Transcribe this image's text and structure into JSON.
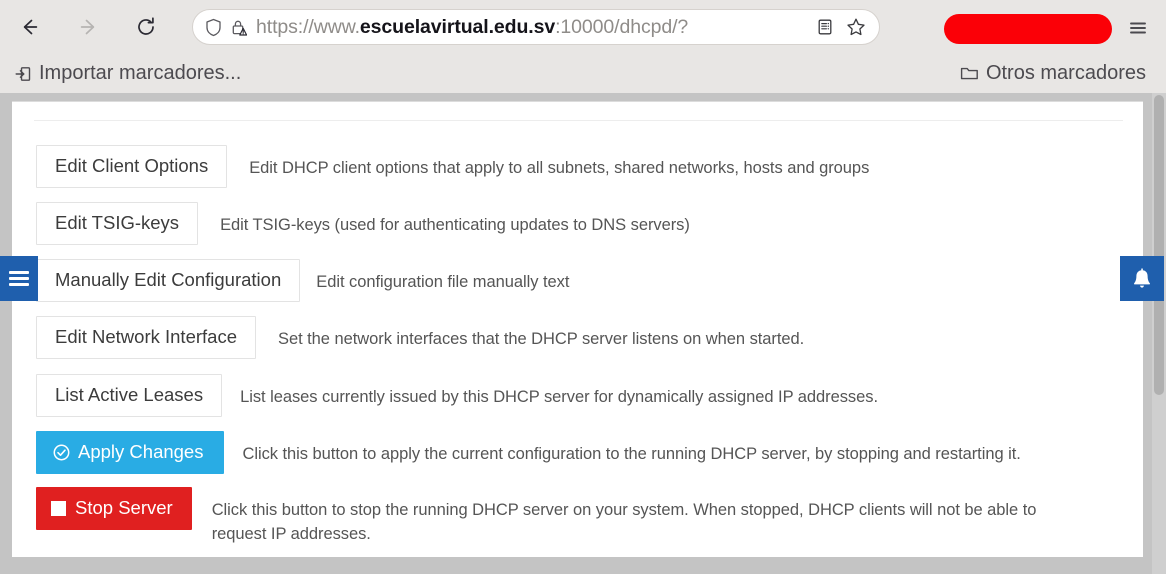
{
  "browser": {
    "nav": {
      "back_icon": "arrow-left-icon",
      "back_label": "←",
      "forward_icon": "arrow-right-icon",
      "forward_label": "→",
      "reload_icon": "reload-icon",
      "reload_label": "⟳"
    },
    "urlbar": {
      "shield_icon": "shield-icon",
      "lock_icon": "lock-warning-icon",
      "url_scheme": "https://www.",
      "url_host": "escuelavirtual.edu.sv",
      "url_tail": ":10000/dhcpd/?",
      "reader_icon": "reader-view-icon",
      "bookmark_icon": "star-icon"
    },
    "profile": {
      "redacted_label": "",
      "menu_icon": "app-menu-icon",
      "menu_label": "≡"
    },
    "bookmarks": {
      "import_icon": "import-bookmarks-icon",
      "import_label": "Importar marcadores...",
      "others_icon": "folder-icon",
      "others_label": "Otros marcadores"
    }
  },
  "page": {
    "left_tab": {
      "icon": "hamburger-menu-icon",
      "label": ""
    },
    "right_tab": {
      "icon": "bell-icon",
      "label": "🔔"
    },
    "rows": [
      {
        "button": "Edit Client Options",
        "description": "Edit DHCP client options that apply to all subnets, shared networks, hosts and groups",
        "style": "default",
        "icon": ""
      },
      {
        "button": "Edit TSIG-keys",
        "description": "Edit TSIG-keys (used for authenticating updates to DNS servers)",
        "style": "default",
        "icon": ""
      },
      {
        "button": "Manually Edit Configuration",
        "description": "Edit configuration file manually text",
        "style": "default",
        "icon": ""
      },
      {
        "button": "Edit Network Interface",
        "description": "Set the network interfaces that the DHCP server listens on when started.",
        "style": "default",
        "icon": ""
      },
      {
        "button": "List Active Leases",
        "description": "List leases currently issued by this DHCP server for dynamically assigned IP addresses.",
        "style": "default",
        "icon": ""
      },
      {
        "button": "Apply Changes",
        "description": "Click this button to apply the current configuration to the running DHCP server, by stopping and restarting it.",
        "style": "primary",
        "icon": "check-circle-icon"
      },
      {
        "button": "Stop Server",
        "description": "Click this button to stop the running DHCP server on your system. When stopped, DHCP clients will not be able to request IP addresses.",
        "style": "danger",
        "icon": "stop-square-icon"
      }
    ]
  },
  "colors": {
    "primary_button": "#29ace4",
    "danger_button": "#e02020",
    "side_tab": "#1f5fad",
    "redaction": "#fb0007",
    "chrome_background": "#e8e6e4",
    "page_background": "#c4c4c4"
  }
}
